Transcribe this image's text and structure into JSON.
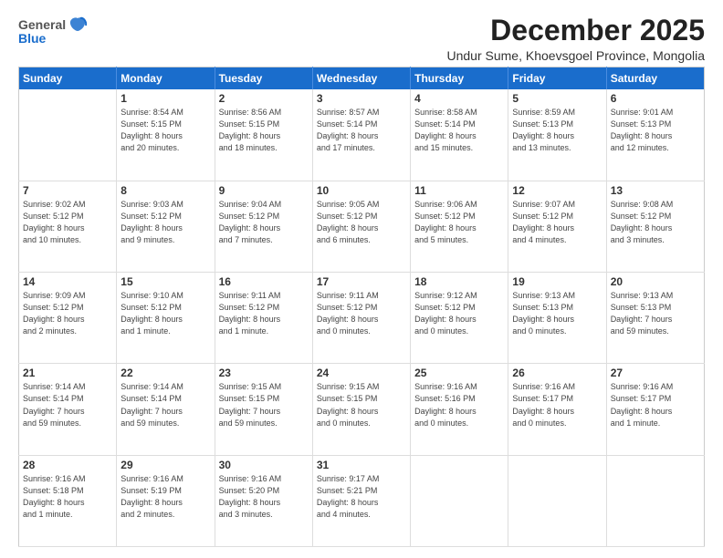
{
  "logo": {
    "general": "General",
    "blue": "Blue"
  },
  "header": {
    "month": "December 2025",
    "location": "Undur Sume, Khoevsgoel Province, Mongolia"
  },
  "weekdays": [
    "Sunday",
    "Monday",
    "Tuesday",
    "Wednesday",
    "Thursday",
    "Friday",
    "Saturday"
  ],
  "weeks": [
    [
      {
        "day": "",
        "lines": []
      },
      {
        "day": "1",
        "lines": [
          "Sunrise: 8:54 AM",
          "Sunset: 5:15 PM",
          "Daylight: 8 hours",
          "and 20 minutes."
        ]
      },
      {
        "day": "2",
        "lines": [
          "Sunrise: 8:56 AM",
          "Sunset: 5:15 PM",
          "Daylight: 8 hours",
          "and 18 minutes."
        ]
      },
      {
        "day": "3",
        "lines": [
          "Sunrise: 8:57 AM",
          "Sunset: 5:14 PM",
          "Daylight: 8 hours",
          "and 17 minutes."
        ]
      },
      {
        "day": "4",
        "lines": [
          "Sunrise: 8:58 AM",
          "Sunset: 5:14 PM",
          "Daylight: 8 hours",
          "and 15 minutes."
        ]
      },
      {
        "day": "5",
        "lines": [
          "Sunrise: 8:59 AM",
          "Sunset: 5:13 PM",
          "Daylight: 8 hours",
          "and 13 minutes."
        ]
      },
      {
        "day": "6",
        "lines": [
          "Sunrise: 9:01 AM",
          "Sunset: 5:13 PM",
          "Daylight: 8 hours",
          "and 12 minutes."
        ]
      }
    ],
    [
      {
        "day": "7",
        "lines": [
          "Sunrise: 9:02 AM",
          "Sunset: 5:12 PM",
          "Daylight: 8 hours",
          "and 10 minutes."
        ]
      },
      {
        "day": "8",
        "lines": [
          "Sunrise: 9:03 AM",
          "Sunset: 5:12 PM",
          "Daylight: 8 hours",
          "and 9 minutes."
        ]
      },
      {
        "day": "9",
        "lines": [
          "Sunrise: 9:04 AM",
          "Sunset: 5:12 PM",
          "Daylight: 8 hours",
          "and 7 minutes."
        ]
      },
      {
        "day": "10",
        "lines": [
          "Sunrise: 9:05 AM",
          "Sunset: 5:12 PM",
          "Daylight: 8 hours",
          "and 6 minutes."
        ]
      },
      {
        "day": "11",
        "lines": [
          "Sunrise: 9:06 AM",
          "Sunset: 5:12 PM",
          "Daylight: 8 hours",
          "and 5 minutes."
        ]
      },
      {
        "day": "12",
        "lines": [
          "Sunrise: 9:07 AM",
          "Sunset: 5:12 PM",
          "Daylight: 8 hours",
          "and 4 minutes."
        ]
      },
      {
        "day": "13",
        "lines": [
          "Sunrise: 9:08 AM",
          "Sunset: 5:12 PM",
          "Daylight: 8 hours",
          "and 3 minutes."
        ]
      }
    ],
    [
      {
        "day": "14",
        "lines": [
          "Sunrise: 9:09 AM",
          "Sunset: 5:12 PM",
          "Daylight: 8 hours",
          "and 2 minutes."
        ]
      },
      {
        "day": "15",
        "lines": [
          "Sunrise: 9:10 AM",
          "Sunset: 5:12 PM",
          "Daylight: 8 hours",
          "and 1 minute."
        ]
      },
      {
        "day": "16",
        "lines": [
          "Sunrise: 9:11 AM",
          "Sunset: 5:12 PM",
          "Daylight: 8 hours",
          "and 1 minute."
        ]
      },
      {
        "day": "17",
        "lines": [
          "Sunrise: 9:11 AM",
          "Sunset: 5:12 PM",
          "Daylight: 8 hours",
          "and 0 minutes."
        ]
      },
      {
        "day": "18",
        "lines": [
          "Sunrise: 9:12 AM",
          "Sunset: 5:12 PM",
          "Daylight: 8 hours",
          "and 0 minutes."
        ]
      },
      {
        "day": "19",
        "lines": [
          "Sunrise: 9:13 AM",
          "Sunset: 5:13 PM",
          "Daylight: 8 hours",
          "and 0 minutes."
        ]
      },
      {
        "day": "20",
        "lines": [
          "Sunrise: 9:13 AM",
          "Sunset: 5:13 PM",
          "Daylight: 7 hours",
          "and 59 minutes."
        ]
      }
    ],
    [
      {
        "day": "21",
        "lines": [
          "Sunrise: 9:14 AM",
          "Sunset: 5:14 PM",
          "Daylight: 7 hours",
          "and 59 minutes."
        ]
      },
      {
        "day": "22",
        "lines": [
          "Sunrise: 9:14 AM",
          "Sunset: 5:14 PM",
          "Daylight: 7 hours",
          "and 59 minutes."
        ]
      },
      {
        "day": "23",
        "lines": [
          "Sunrise: 9:15 AM",
          "Sunset: 5:15 PM",
          "Daylight: 7 hours",
          "and 59 minutes."
        ]
      },
      {
        "day": "24",
        "lines": [
          "Sunrise: 9:15 AM",
          "Sunset: 5:15 PM",
          "Daylight: 8 hours",
          "and 0 minutes."
        ]
      },
      {
        "day": "25",
        "lines": [
          "Sunrise: 9:16 AM",
          "Sunset: 5:16 PM",
          "Daylight: 8 hours",
          "and 0 minutes."
        ]
      },
      {
        "day": "26",
        "lines": [
          "Sunrise: 9:16 AM",
          "Sunset: 5:17 PM",
          "Daylight: 8 hours",
          "and 0 minutes."
        ]
      },
      {
        "day": "27",
        "lines": [
          "Sunrise: 9:16 AM",
          "Sunset: 5:17 PM",
          "Daylight: 8 hours",
          "and 1 minute."
        ]
      }
    ],
    [
      {
        "day": "28",
        "lines": [
          "Sunrise: 9:16 AM",
          "Sunset: 5:18 PM",
          "Daylight: 8 hours",
          "and 1 minute."
        ]
      },
      {
        "day": "29",
        "lines": [
          "Sunrise: 9:16 AM",
          "Sunset: 5:19 PM",
          "Daylight: 8 hours",
          "and 2 minutes."
        ]
      },
      {
        "day": "30",
        "lines": [
          "Sunrise: 9:16 AM",
          "Sunset: 5:20 PM",
          "Daylight: 8 hours",
          "and 3 minutes."
        ]
      },
      {
        "day": "31",
        "lines": [
          "Sunrise: 9:17 AM",
          "Sunset: 5:21 PM",
          "Daylight: 8 hours",
          "and 4 minutes."
        ]
      },
      {
        "day": "",
        "lines": []
      },
      {
        "day": "",
        "lines": []
      },
      {
        "day": "",
        "lines": []
      }
    ]
  ]
}
